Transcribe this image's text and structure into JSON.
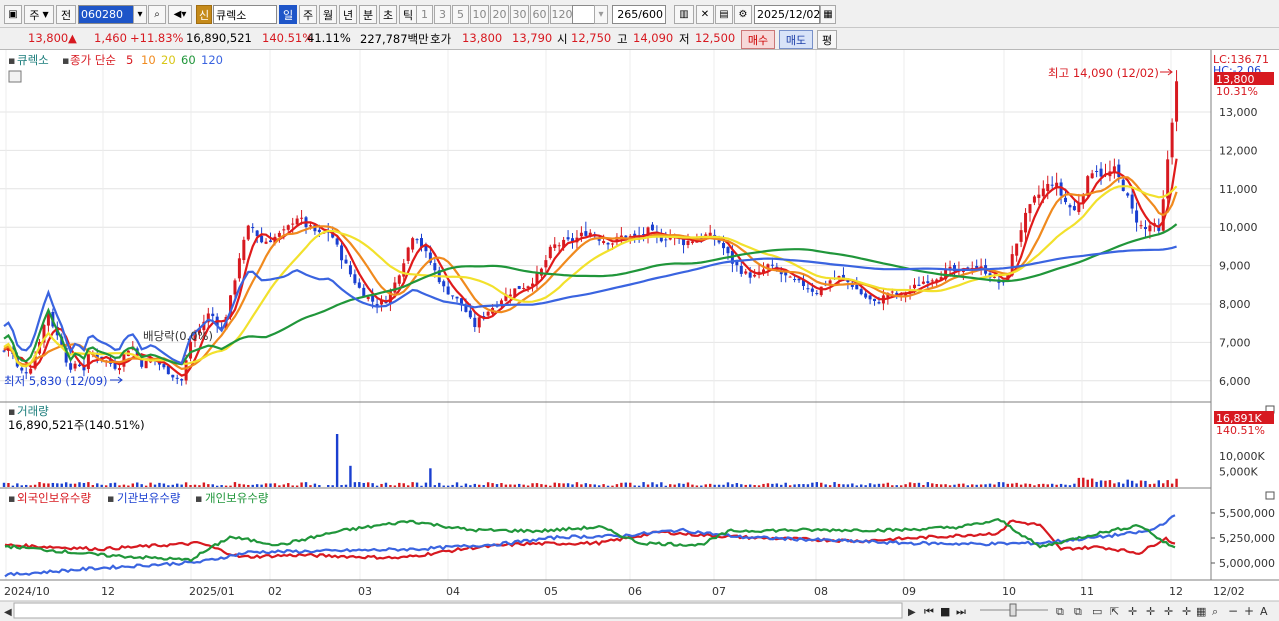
{
  "toolbar": {
    "market_label": "주",
    "prev_label": "전",
    "code": "060280",
    "credit_badge": "신",
    "name": "큐렉소",
    "periods": [
      "일",
      "주",
      "월",
      "년",
      "분",
      "초",
      "틱"
    ],
    "intervals": [
      "1",
      "3",
      "5",
      "10",
      "20",
      "30",
      "60",
      "120"
    ],
    "count": "265",
    "count_max": "/600",
    "date": "2025/12/02"
  },
  "quote": {
    "price": "13,800",
    "up_arrow": "▲",
    "change": "1,460",
    "change_pct": "+11.83%",
    "volume": "16,890,521",
    "vol_ratio": "140.51%",
    "turnover": "41.11%",
    "amount": "227,787백만",
    "ask_label": "호가",
    "ask": "13,800",
    "bid": "13,790",
    "open_label": "시",
    "open": "12,750",
    "high_label": "고",
    "high": "14,090",
    "low_label": "저",
    "low": "12,500",
    "buy_label": "매수",
    "sell_label": "매도",
    "eval_label": "평"
  },
  "panels": {
    "price_name": "큐렉소",
    "ma_label": "종가 단순",
    "ma_periods": [
      "5",
      "10",
      "20",
      "60",
      "120"
    ],
    "lc_label": "LC:136.71",
    "hc_label": "HC:-2.06",
    "cur_label": "13,800",
    "cur_pct": "10.31%",
    "vol_title": "거래량",
    "vol_info": "16,890,521주(140.51%)",
    "vol_box": "16,891K",
    "vol_pct": "140.51%",
    "own_titles": [
      "외국인보유수량",
      "기관보유수량",
      "개인보유수량"
    ]
  },
  "chart_data": {
    "type": "candlestick",
    "x": [
      "2024/10",
      "12",
      "2025/01",
      "02",
      "03",
      "04",
      "05",
      "06",
      "07",
      "08",
      "09",
      "10",
      "11",
      "12"
    ],
    "end_label": "12/02",
    "price_ticks": [
      6000,
      7000,
      8000,
      9000,
      10000,
      11000,
      12000,
      13000
    ],
    "ylim": [
      5500,
      14250
    ],
    "annotations": {
      "high": "최고 14,090 (12/02)",
      "low": "최저 5,830 (12/09)",
      "dividend": "배당락(0.0%)"
    },
    "colors": {
      "up": "#d71920",
      "down": "#1a3fd0",
      "ma5": "#e01b1b",
      "ma10": "#f08a1e",
      "ma20": "#f2e12c",
      "ma60": "#20963a",
      "ma120": "#3a64e0"
    },
    "volume_ticks": [
      "5,000K",
      "10,000K"
    ],
    "volume_max_k": 17000,
    "holding_ticks": [
      "5,000,000",
      "5,250,000",
      "5,500,000"
    ],
    "holding_ylim": [
      4850000,
      5550000
    ],
    "anchors": [
      [
        0,
        6700
      ],
      [
        10,
        6900
      ],
      [
        18,
        6300
      ],
      [
        25,
        6200
      ],
      [
        32,
        6400
      ],
      [
        40,
        7100
      ],
      [
        48,
        7800
      ],
      [
        55,
        7300
      ],
      [
        62,
        6900
      ],
      [
        70,
        6200
      ],
      [
        76,
        6500
      ],
      [
        84,
        6300
      ],
      [
        90,
        6800
      ],
      [
        98,
        6600
      ],
      [
        108,
        6500
      ],
      [
        118,
        6300
      ],
      [
        126,
        6800
      ],
      [
        134,
        6900
      ],
      [
        142,
        6400
      ],
      [
        152,
        6600
      ],
      [
        165,
        6300
      ],
      [
        174,
        6100
      ],
      [
        182,
        6000
      ],
      [
        190,
        7000
      ],
      [
        198,
        7300
      ],
      [
        210,
        7800
      ],
      [
        222,
        7300
      ],
      [
        232,
        8300
      ],
      [
        240,
        9300
      ],
      [
        250,
        10100
      ],
      [
        262,
        9600
      ],
      [
        272,
        9700
      ],
      [
        286,
        9900
      ],
      [
        296,
        10300
      ],
      [
        308,
        10000
      ],
      [
        320,
        9800
      ],
      [
        330,
        9900
      ],
      [
        340,
        9300
      ],
      [
        352,
        8700
      ],
      [
        362,
        8300
      ],
      [
        376,
        8000
      ],
      [
        386,
        8100
      ],
      [
        396,
        8600
      ],
      [
        406,
        9300
      ],
      [
        414,
        9900
      ],
      [
        424,
        9400
      ],
      [
        434,
        8900
      ],
      [
        444,
        8400
      ],
      [
        454,
        8200
      ],
      [
        464,
        7900
      ],
      [
        474,
        7400
      ],
      [
        482,
        7700
      ],
      [
        492,
        7900
      ],
      [
        504,
        8200
      ],
      [
        516,
        8400
      ],
      [
        528,
        8500
      ],
      [
        540,
        8800
      ],
      [
        552,
        9500
      ],
      [
        566,
        9600
      ],
      [
        576,
        9700
      ],
      [
        588,
        9900
      ],
      [
        600,
        9700
      ],
      [
        612,
        9600
      ],
      [
        624,
        9800
      ],
      [
        636,
        9700
      ],
      [
        648,
        9900
      ],
      [
        660,
        9700
      ],
      [
        672,
        9800
      ],
      [
        684,
        9600
      ],
      [
        696,
        9700
      ],
      [
        708,
        9800
      ],
      [
        720,
        9600
      ],
      [
        732,
        9100
      ],
      [
        744,
        8800
      ],
      [
        756,
        8700
      ],
      [
        768,
        9000
      ],
      [
        780,
        8800
      ],
      [
        792,
        8600
      ],
      [
        804,
        8500
      ],
      [
        816,
        8300
      ],
      [
        828,
        8600
      ],
      [
        840,
        8700
      ],
      [
        852,
        8500
      ],
      [
        864,
        8200
      ],
      [
        876,
        8000
      ],
      [
        888,
        8300
      ],
      [
        900,
        8200
      ],
      [
        912,
        8400
      ],
      [
        924,
        8600
      ],
      [
        936,
        8700
      ],
      [
        948,
        8900
      ],
      [
        960,
        8800
      ],
      [
        972,
        9000
      ],
      [
        984,
        8900
      ],
      [
        996,
        8600
      ],
      [
        1004,
        8500
      ],
      [
        1014,
        9400
      ],
      [
        1024,
        10200
      ],
      [
        1034,
        10700
      ],
      [
        1044,
        11000
      ],
      [
        1054,
        11200
      ],
      [
        1064,
        10700
      ],
      [
        1074,
        10400
      ],
      [
        1084,
        11000
      ],
      [
        1094,
        11600
      ],
      [
        1104,
        11300
      ],
      [
        1114,
        11500
      ],
      [
        1124,
        11000
      ],
      [
        1134,
        10300
      ],
      [
        1144,
        9900
      ],
      [
        1152,
        10100
      ],
      [
        1160,
        9800
      ],
      [
        1166,
        11400
      ],
      [
        1170,
        12300
      ],
      [
        1174,
        13300
      ],
      [
        1177,
        13800
      ]
    ]
  }
}
